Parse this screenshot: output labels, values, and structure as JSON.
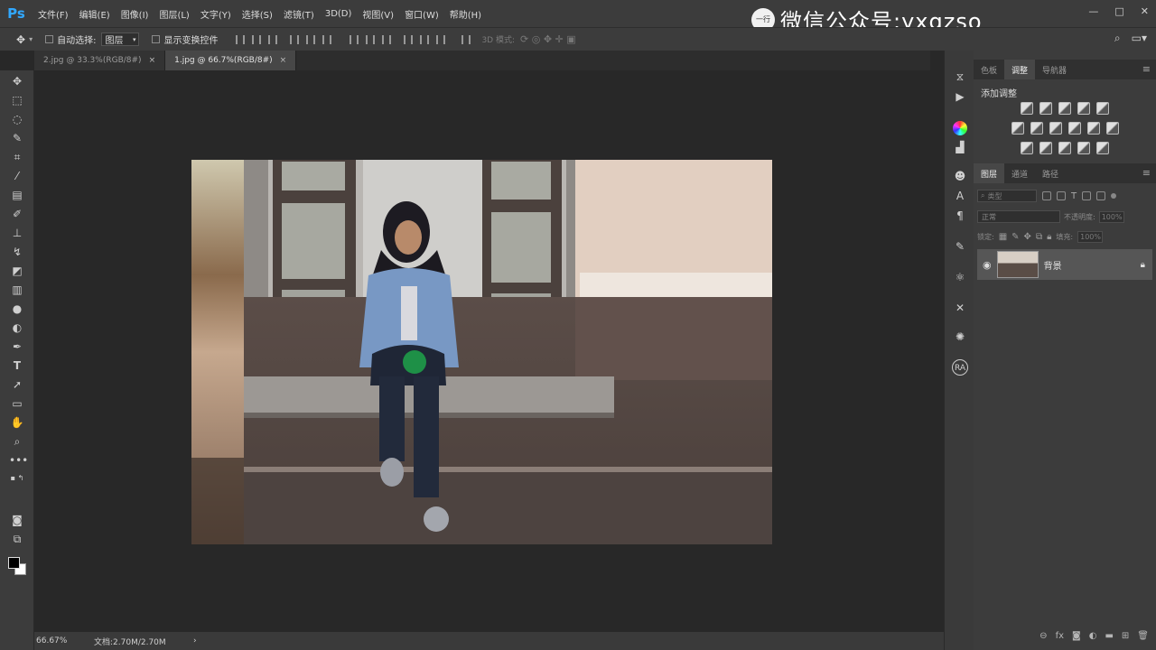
{
  "app": {
    "logo": "Ps",
    "menu": [
      "文件(F)",
      "编辑(E)",
      "图像(I)",
      "图层(L)",
      "文字(Y)",
      "选择(S)",
      "滤镜(T)",
      "3D(D)",
      "视图(V)",
      "窗口(W)",
      "帮助(H)"
    ],
    "watermark": "微信公众号:yxgzso",
    "watermark_logo": "一行"
  },
  "options": {
    "auto_select_label": "自动选择:",
    "auto_select_value": "图层",
    "show_transform_label": "显示变换控件",
    "mode_3d_label": "3D 模式:"
  },
  "tabs": [
    {
      "label": "2.jpg @ 33.3%(RGB/8#)",
      "close": "×"
    },
    {
      "label": "1.jpg @ 66.7%(RGB/8#)",
      "close": "×"
    }
  ],
  "status": {
    "zoom": "66.67%",
    "doc": "文档:2.70M/2.70M",
    "arrow": "›"
  },
  "adjust_panel": {
    "tabs": [
      "色板",
      "调整",
      "导航器"
    ],
    "add_label": "添加调整"
  },
  "layers_panel": {
    "tabs": [
      "图层",
      "通道",
      "路径"
    ],
    "kind_placeholder": "类型",
    "blend_mode": "正常",
    "opacity_label": "不透明度:",
    "opacity_value": "100%",
    "lock_label": "锁定:",
    "fill_label": "填充:",
    "fill_value": "100%",
    "layer_name": "背景"
  }
}
